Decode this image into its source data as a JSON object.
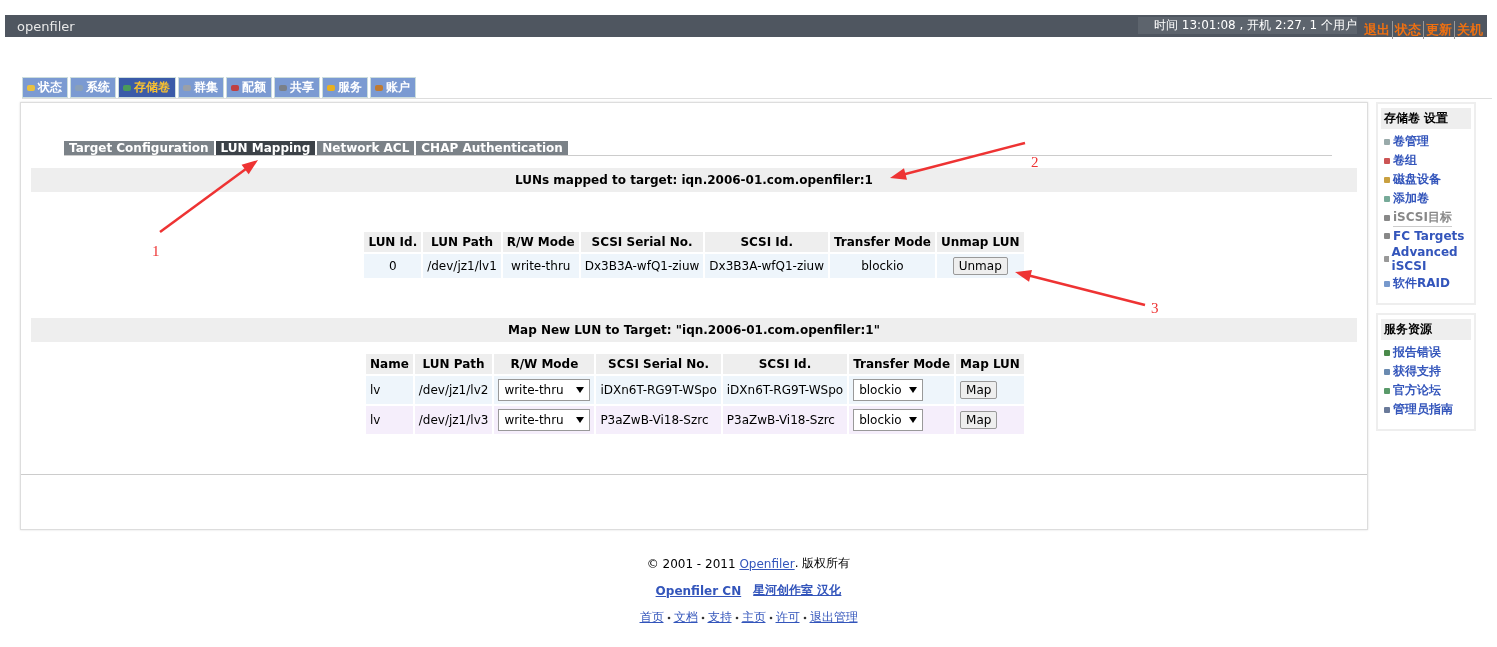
{
  "header": {
    "logo": "openfiler",
    "status": "时间 13:01:08 , 开机 2:27, 1 个用户",
    "links": [
      "退出",
      "状态",
      "更新",
      "关机"
    ]
  },
  "tabs": [
    {
      "label": "状态",
      "selected": false
    },
    {
      "label": "系统",
      "selected": false
    },
    {
      "label": "存储卷",
      "selected": true
    },
    {
      "label": "群集",
      "selected": false
    },
    {
      "label": "配额",
      "selected": false
    },
    {
      "label": "共享",
      "selected": false
    },
    {
      "label": "服务",
      "selected": false
    },
    {
      "label": "账户",
      "selected": false
    }
  ],
  "subtabs": [
    {
      "label": "Target Configuration",
      "selected": false
    },
    {
      "label": "LUN Mapping",
      "selected": true
    },
    {
      "label": "Network ACL",
      "selected": false
    },
    {
      "label": "CHAP Authentication",
      "selected": false
    }
  ],
  "mapped": {
    "title": "LUNs mapped to target: iqn.2006-01.com.openfiler:1",
    "columns": [
      "LUN Id.",
      "LUN Path",
      "R/W Mode",
      "SCSI Serial No.",
      "SCSI Id.",
      "Transfer Mode",
      "Unmap LUN"
    ],
    "rows": [
      {
        "lun_id": "0",
        "path": "/dev/jz1/lv1",
        "mode": "write-thru",
        "serial": "Dx3B3A-wfQ1-ziuw",
        "scsi_id": "Dx3B3A-wfQ1-ziuw",
        "transfer": "blockio",
        "button": "Unmap"
      }
    ]
  },
  "map_new": {
    "title": "Map New LUN to Target: \"iqn.2006-01.com.openfiler:1\"",
    "columns": [
      "Name",
      "LUN Path",
      "R/W Mode",
      "SCSI Serial No.",
      "SCSI Id.",
      "Transfer Mode",
      "Map LUN"
    ],
    "rows": [
      {
        "name": "lv",
        "path": "/dev/jz1/lv2",
        "mode": "write-thru",
        "serial": "iDXn6T-RG9T-WSpo",
        "scsi_id": "iDXn6T-RG9T-WSpo",
        "transfer": "blockio",
        "button": "Map"
      },
      {
        "name": "lv",
        "path": "/dev/jz1/lv3",
        "mode": "write-thru",
        "serial": "P3aZwB-Vi18-Szrc",
        "scsi_id": "P3aZwB-Vi18-Szrc",
        "transfer": "blockio",
        "button": "Map"
      }
    ]
  },
  "sidebar": [
    {
      "title": "存储卷 设置",
      "items": [
        {
          "label": "卷管理",
          "selected": false
        },
        {
          "label": "卷组",
          "selected": false
        },
        {
          "label": "磁盘设备",
          "selected": false
        },
        {
          "label": "添加卷",
          "selected": false
        },
        {
          "label": "iSCSI目标",
          "selected": true
        },
        {
          "label": "FC Targets",
          "selected": false
        },
        {
          "label": "Advanced iSCSI",
          "selected": false
        },
        {
          "label": "软件RAID",
          "selected": false
        }
      ]
    },
    {
      "title": "服务资源",
      "items": [
        {
          "label": "报告错误",
          "selected": false
        },
        {
          "label": "获得支持",
          "selected": false
        },
        {
          "label": "官方论坛",
          "selected": false
        },
        {
          "label": "管理员指南",
          "selected": false
        }
      ]
    }
  ],
  "footer": {
    "copyright_prefix": "© 2001 - 2011",
    "copyright_link": "Openfiler",
    "copyright_suffix": ". 版权所有",
    "credits": [
      "Openfiler CN",
      "星河创作室 汉化"
    ],
    "links": [
      "首页",
      "文档",
      "支持",
      "主页",
      "许可",
      "退出管理"
    ]
  },
  "annotations": [
    {
      "label": "1"
    },
    {
      "label": "2"
    },
    {
      "label": "3"
    }
  ]
}
